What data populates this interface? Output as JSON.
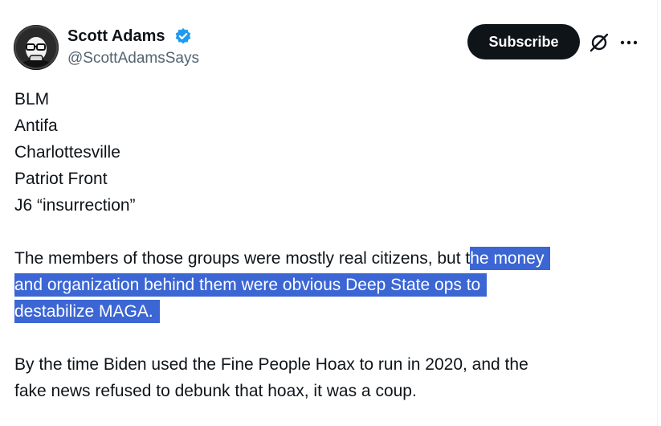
{
  "author": {
    "display_name": "Scott Adams",
    "handle": "@ScottAdamsSays",
    "verified": true,
    "avatar_icon": "cartoon-avatar-icon"
  },
  "actions": {
    "subscribe_label": "Subscribe",
    "grok_icon": "grok-icon",
    "more_icon": "more-options-icon"
  },
  "post": {
    "lines": [
      "BLM",
      "Antifa",
      "Charlottesville",
      "Patriot Front",
      "J6 “insurrection”"
    ],
    "paragraph2": {
      "line1_plain": "The members of those groups were mostly real citizens, but t",
      "line1_selected": "he money",
      "line2_selected": "and organization behind them were obvious Deep State ops to",
      "line3_selected": "destabilize MAGA."
    },
    "paragraph3": {
      "line1": "By the time Biden used the Fine People Hoax to run in 2020, and the",
      "line2": "fake news refused to debunk that hoax, it was a coup."
    }
  },
  "colors": {
    "text": "#0f1419",
    "secondary_text": "#536471",
    "verified_blue": "#1d9bf0",
    "subscribe_bg": "#0f1419",
    "selection": "#3b66d4"
  }
}
